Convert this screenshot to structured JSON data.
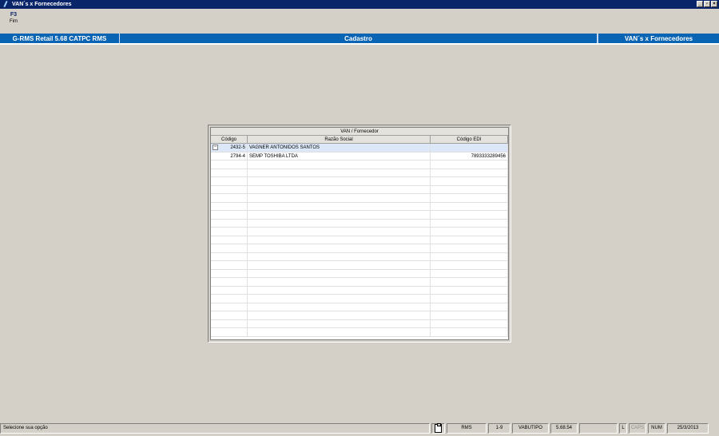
{
  "window": {
    "title": "VAN´s x Fornecedores"
  },
  "toolbar": {
    "key": "F3",
    "key_label": "Fim"
  },
  "header": {
    "left": "G-RMS Retail 5.68 CATPC RMS",
    "center": "Cadastro",
    "right": "VAN´s x Fornecedores"
  },
  "grid": {
    "group_header": "VAN / Fornecedor",
    "columns": [
      "Código",
      "Razão Social",
      "Código EDI"
    ],
    "rows": [
      {
        "code": "2432-5",
        "name": "VAGNER ANTONIDOS SANTOS",
        "edi": ""
      },
      {
        "code": "2794-4",
        "name": "SEMP TOSHIBA LTDA",
        "edi": "7893333289456"
      }
    ]
  },
  "statusbar": {
    "message": "Selecione sua opção",
    "system": "RMS",
    "range": "1-9",
    "user": "VABUTIPO",
    "version": "5.68.54",
    "l": "L",
    "caps": "CAPS",
    "num": "NUM",
    "date": "25/3/2013"
  }
}
